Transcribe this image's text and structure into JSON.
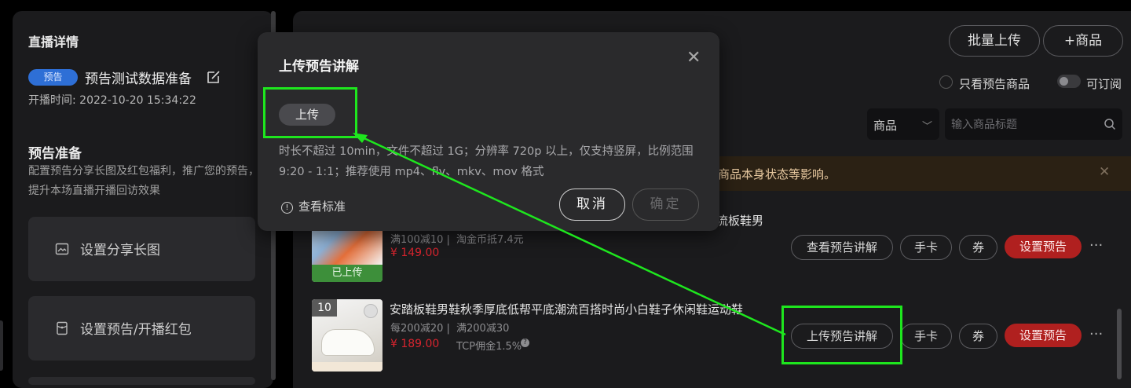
{
  "left": {
    "title": "直播详情",
    "badge": "预告",
    "live_title": "预告测试数据准备",
    "start_time": "开播时间: 2022-10-20 15:34:22",
    "section_title": "预告准备",
    "section_desc": "配置预告分享长图及红包福利，推广您的预告，提升本场直播开播回访效果",
    "cards": [
      {
        "label": "设置分享长图",
        "icon": "image-icon"
      },
      {
        "label": "设置预告/开播红包",
        "icon": "redpacket-icon"
      }
    ]
  },
  "header": {
    "batch_upload": "批量上传",
    "add_product": "+商品",
    "only_preview": "只看预告商品",
    "subscribable": "可订阅",
    "select_value": "商品",
    "search_placeholder": "输入商品标题"
  },
  "notice": {
    "text": "商品本身状态等影响。"
  },
  "products": [
    {
      "title_tail": "流板鞋男",
      "promo": "满100减10 |",
      "promo2": "淘金币抵7.4元",
      "price": "¥ 149.00",
      "status": "已上传",
      "buttons": {
        "explain": "查看预告讲解",
        "card": "手卡",
        "coupon": "券",
        "set": "设置预告",
        "more": "···"
      }
    },
    {
      "index": "10",
      "title": "安踏板鞋男鞋秋季厚底低帮平底潮流百搭时尚小白鞋子休闲鞋运动鞋",
      "promo": "每200减20 |",
      "promo2": "满200减30",
      "price": "¥ 189.00",
      "commission": "TCP佣金1.5%",
      "buttons": {
        "explain": "上传预告讲解",
        "card": "手卡",
        "coupon": "券",
        "set": "设置预告",
        "more": "···"
      }
    }
  ],
  "modal": {
    "title": "上传预告讲解",
    "upload": "上传",
    "desc": "时长不超过 10min，文件不超过 1G；分辨率 720p 以上，仅支持竖屏，比例范围 9:20 - 1:1；推荐使用 mp4、flv、mkv、mov 格式",
    "view_standard": "查看标准",
    "cancel": "取消",
    "confirm": "确定"
  },
  "colors": {
    "highlight": "#1ee61e",
    "accent_red": "#b0201f",
    "badge_blue": "#2e6fd6"
  }
}
